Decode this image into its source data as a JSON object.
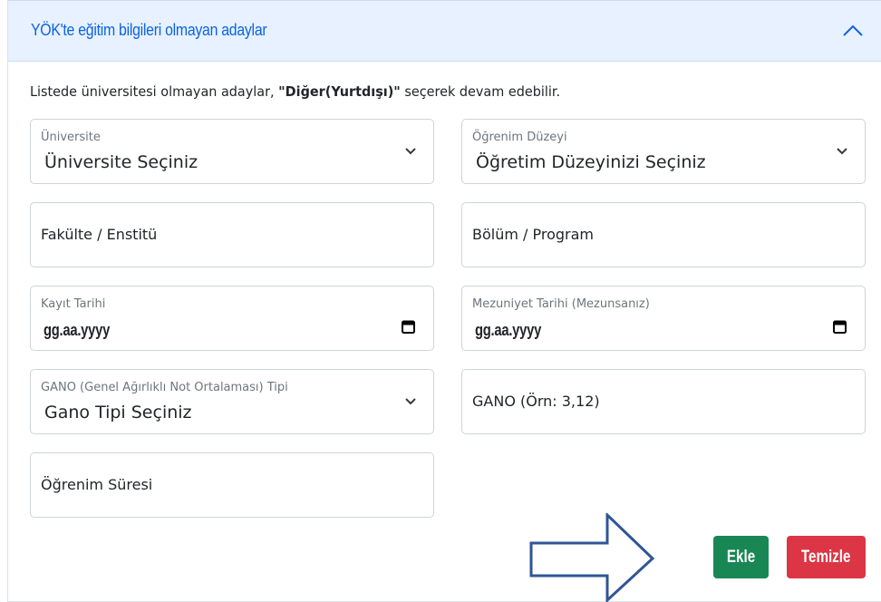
{
  "header": {
    "title": "YÖK'te eğitim bilgileri olmayan adaylar",
    "toggle_icon": "chevron-up-icon"
  },
  "info": {
    "prefix": "Listede üniversitesi olmayan adaylar, ",
    "highlight": "\"Diğer(Yurtdışı)\"",
    "suffix": " seçerek devam edebilir."
  },
  "fields": {
    "university": {
      "label": "Üniversite",
      "value": "Üniversite Seçiniz"
    },
    "level": {
      "label": "Öğrenim Düzeyi",
      "value": "Öğretim Düzeyinizi Seçiniz"
    },
    "faculty": {
      "placeholder": "Fakülte / Enstitü"
    },
    "department": {
      "placeholder": "Bölüm / Program"
    },
    "enroll_date": {
      "label": "Kayıt Tarihi",
      "value": "gg.aa.yyyy"
    },
    "grad_date": {
      "label": "Mezuniyet Tarihi (Mezunsanız)",
      "value": "gg.aa.yyyy"
    },
    "gpa_type": {
      "label": "GANO (Genel Ağırlıklı Not Ortalaması) Tipi",
      "value": "Gano Tipi Seçiniz"
    },
    "gpa": {
      "placeholder": "GANO (Örn: 3,12)"
    },
    "duration": {
      "placeholder": "Öğrenim Süresi"
    }
  },
  "buttons": {
    "add": "Ekle",
    "clear": "Temizle"
  },
  "colors": {
    "header_bg": "#e7f1ff",
    "header_text": "#0c63e4",
    "add": "#198754",
    "clear": "#dc3545",
    "arrow": "#2f5597"
  }
}
